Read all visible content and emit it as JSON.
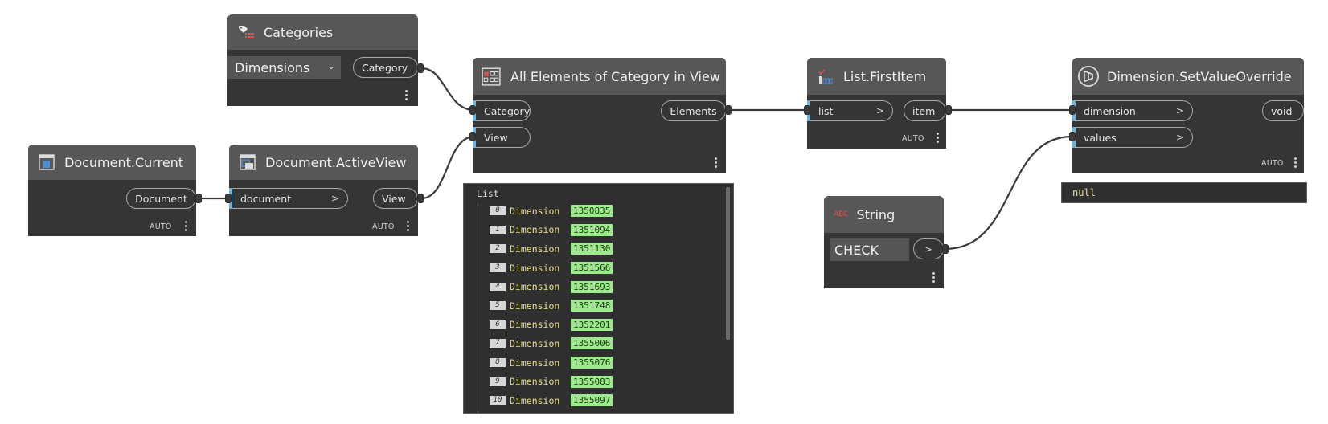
{
  "nodes": {
    "categories": {
      "title": "Categories",
      "dropdown_value": "Dimensions",
      "output": "Category"
    },
    "document_current": {
      "title": "Document.Current",
      "output": "Document",
      "lacing": "AUTO"
    },
    "active_view": {
      "title": "Document.ActiveView",
      "input": "document",
      "output": "View",
      "lacing": "AUTO"
    },
    "all_elements": {
      "title": "All Elements of Category in View",
      "inputs": [
        "Category",
        "View"
      ],
      "output": "Elements"
    },
    "first_item": {
      "title": "List.FirstItem",
      "input": "list",
      "output": "item",
      "lacing": "AUTO"
    },
    "string": {
      "title": "String",
      "icon_text": "ABC",
      "value": "CHECK"
    },
    "set_value_override": {
      "title": "Dimension.SetValueOverride",
      "inputs": [
        "dimension",
        "values"
      ],
      "output": "void",
      "lacing": "AUTO"
    }
  },
  "list_preview": {
    "title": "List",
    "items": [
      {
        "index": "0",
        "type": "Dimension",
        "id": "1350835"
      },
      {
        "index": "1",
        "type": "Dimension",
        "id": "1351094"
      },
      {
        "index": "2",
        "type": "Dimension",
        "id": "1351130"
      },
      {
        "index": "3",
        "type": "Dimension",
        "id": "1351566"
      },
      {
        "index": "4",
        "type": "Dimension",
        "id": "1351693"
      },
      {
        "index": "5",
        "type": "Dimension",
        "id": "1351748"
      },
      {
        "index": "6",
        "type": "Dimension",
        "id": "1352201"
      },
      {
        "index": "7",
        "type": "Dimension",
        "id": "1355006"
      },
      {
        "index": "8",
        "type": "Dimension",
        "id": "1355076"
      },
      {
        "index": "9",
        "type": "Dimension",
        "id": "1355083"
      },
      {
        "index": "10",
        "type": "Dimension",
        "id": "1355097"
      }
    ]
  },
  "output_preview": {
    "value": "null"
  },
  "colors": {
    "canvas": "#ffffff",
    "node_body": "#353535",
    "node_header": "#575757",
    "input_accent": "#6ab6e2",
    "wire": "#3a3a3a",
    "preview_value": "#9dea8c",
    "preview_text": "#e8e08a"
  },
  "icons": {
    "categories": "tag-list-icon",
    "document_current": "document-icon",
    "active_view": "view-window-icon",
    "all_elements": "elements-grid-icon",
    "first_item": "list-first-item-icon",
    "set_value_override": "dimension-override-icon"
  }
}
